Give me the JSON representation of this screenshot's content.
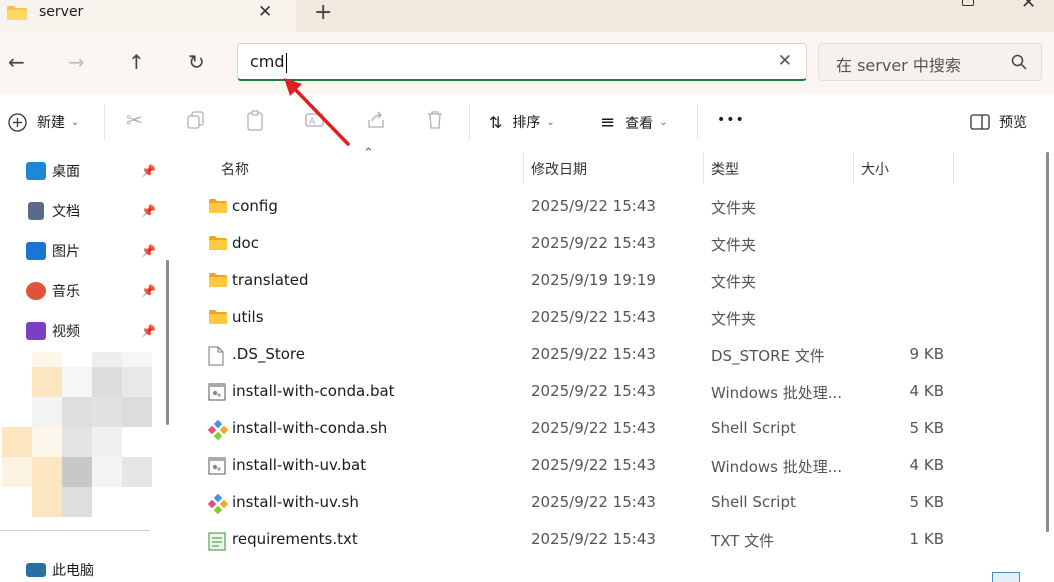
{
  "window": {
    "tab_title": "server"
  },
  "address_bar": {
    "value": "cmd"
  },
  "search": {
    "placeholder": "在 server 中搜索"
  },
  "toolbar": {
    "new_label": "新建",
    "sort_label": "排序",
    "view_label": "查看",
    "more_label": "•••",
    "preview_label": "预览"
  },
  "sidebar": {
    "items": [
      {
        "label": "桌面",
        "icon": "desktop-icon",
        "color": "#1e88d8"
      },
      {
        "label": "文档",
        "icon": "document-icon",
        "color": "#5a6b8a"
      },
      {
        "label": "图片",
        "icon": "pictures-icon",
        "color": "#1a76d2"
      },
      {
        "label": "音乐",
        "icon": "music-icon",
        "color": "#e0533b"
      },
      {
        "label": "视频",
        "icon": "video-icon",
        "color": "#7b3fc4"
      }
    ],
    "bottom_partial": "此电脑"
  },
  "columns": {
    "name": "名称",
    "date": "修改日期",
    "type": "类型",
    "size": "大小"
  },
  "files": [
    {
      "name": "config",
      "date": "2025/9/22 15:43",
      "type": "文件夹",
      "size": "",
      "icon": "folder-icon"
    },
    {
      "name": "doc",
      "date": "2025/9/22 15:43",
      "type": "文件夹",
      "size": "",
      "icon": "folder-icon"
    },
    {
      "name": "translated",
      "date": "2025/9/19 19:19",
      "type": "文件夹",
      "size": "",
      "icon": "folder-icon"
    },
    {
      "name": "utils",
      "date": "2025/9/22 15:43",
      "type": "文件夹",
      "size": "",
      "icon": "folder-icon"
    },
    {
      "name": ".DS_Store",
      "date": "2025/9/22 15:43",
      "type": "DS_STORE 文件",
      "size": "9 KB",
      "icon": "file-icon"
    },
    {
      "name": "install-with-conda.bat",
      "date": "2025/9/22 15:43",
      "type": "Windows 批处理...",
      "size": "4 KB",
      "icon": "batch-file-icon"
    },
    {
      "name": "install-with-conda.sh",
      "date": "2025/9/22 15:43",
      "type": "Shell Script",
      "size": "5 KB",
      "icon": "shell-script-icon"
    },
    {
      "name": "install-with-uv.bat",
      "date": "2025/9/22 15:43",
      "type": "Windows 批处理...",
      "size": "4 KB",
      "icon": "batch-file-icon"
    },
    {
      "name": "install-with-uv.sh",
      "date": "2025/9/22 15:43",
      "type": "Shell Script",
      "size": "5 KB",
      "icon": "shell-script-icon"
    },
    {
      "name": "requirements.txt",
      "date": "2025/9/22 15:43",
      "type": "TXT 文件",
      "size": "1 KB",
      "icon": "text-file-icon"
    }
  ],
  "colors": {
    "accent_green": "#1e7b3a",
    "annotation_red": "#e02020",
    "folder_yellow": "#f5c242"
  }
}
